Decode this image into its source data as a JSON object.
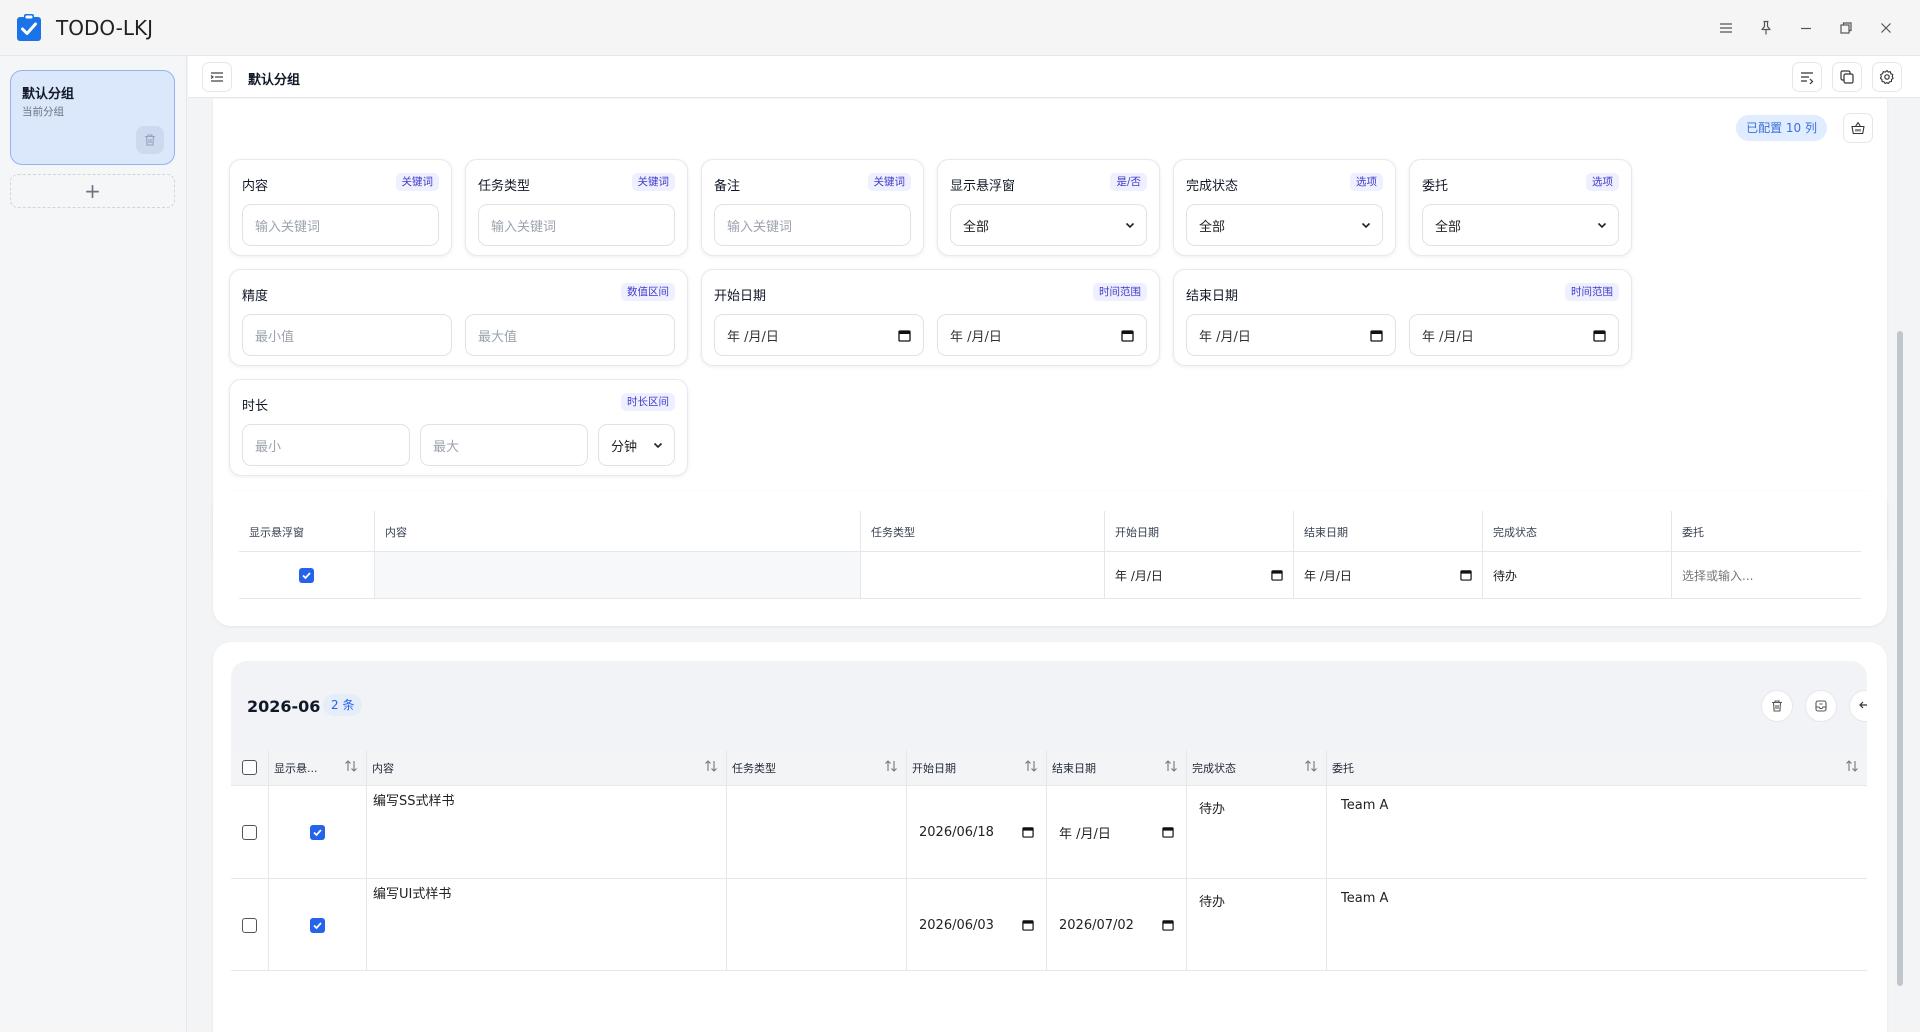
{
  "app": {
    "title": "TODO-LKJ"
  },
  "sidebar": {
    "groups": [
      {
        "name": "默认分组",
        "subtitle": "当前分组"
      }
    ],
    "add_label": "+"
  },
  "topbar": {
    "title": "默认分组"
  },
  "filter": {
    "configured_badge": "已配置 10 列",
    "content": {
      "label": "内容",
      "tag": "关键词",
      "placeholder": "输入关键词"
    },
    "task_type": {
      "label": "任务类型",
      "tag": "关键词",
      "placeholder": "输入关键词"
    },
    "remark": {
      "label": "备注",
      "tag": "关键词",
      "placeholder": "输入关键词"
    },
    "float_window": {
      "label": "显示悬浮窗",
      "tag": "是/否",
      "value": "全部"
    },
    "status": {
      "label": "完成状态",
      "tag": "选项",
      "value": "全部"
    },
    "delegate": {
      "label": "委托",
      "tag": "选项",
      "value": "全部"
    },
    "precision": {
      "label": "精度",
      "tag": "数值区间",
      "min_placeholder": "最小值",
      "max_placeholder": "最大值"
    },
    "start_date": {
      "label": "开始日期",
      "tag": "时间范围",
      "from": "年 /月/日",
      "to": "年 /月/日"
    },
    "end_date": {
      "label": "结束日期",
      "tag": "时间范围",
      "from": "年 /月/日",
      "to": "年 /月/日"
    },
    "duration": {
      "label": "时长",
      "tag": "时长区间",
      "min_placeholder": "最小",
      "max_placeholder": "最大",
      "unit": "分钟"
    }
  },
  "editor": {
    "headers": [
      "显示悬浮窗",
      "内容",
      "任务类型",
      "开始日期",
      "结束日期",
      "完成状态",
      "委托"
    ],
    "row": {
      "float_checked": true,
      "content": "",
      "task_type": "",
      "start_date": "年 /月/日",
      "end_date": "年 /月/日",
      "status": "待办",
      "delegate_placeholder": "选择或输入..."
    }
  },
  "list": {
    "month": "2026-06",
    "count": "2 条",
    "headers": [
      "显示悬...",
      "内容",
      "任务类型",
      "开始日期",
      "结束日期",
      "完成状态",
      "委托"
    ],
    "rows": [
      {
        "content": "编写SS式样书",
        "task_type": "",
        "start_date": "2026/06/18",
        "end_date": "年 /月/日",
        "status": "待办",
        "delegate": "Team A",
        "checked": false,
        "float": true
      },
      {
        "content": "编写UI式样书",
        "task_type": "",
        "start_date": "2026/06/03",
        "end_date": "2026/07/02",
        "status": "待办",
        "delegate": "Team A",
        "checked": false,
        "float": true
      }
    ]
  },
  "colors": {
    "accent": "#2563eb",
    "selected_group": "#dbe7fb",
    "tag_text": "#4338ca"
  }
}
